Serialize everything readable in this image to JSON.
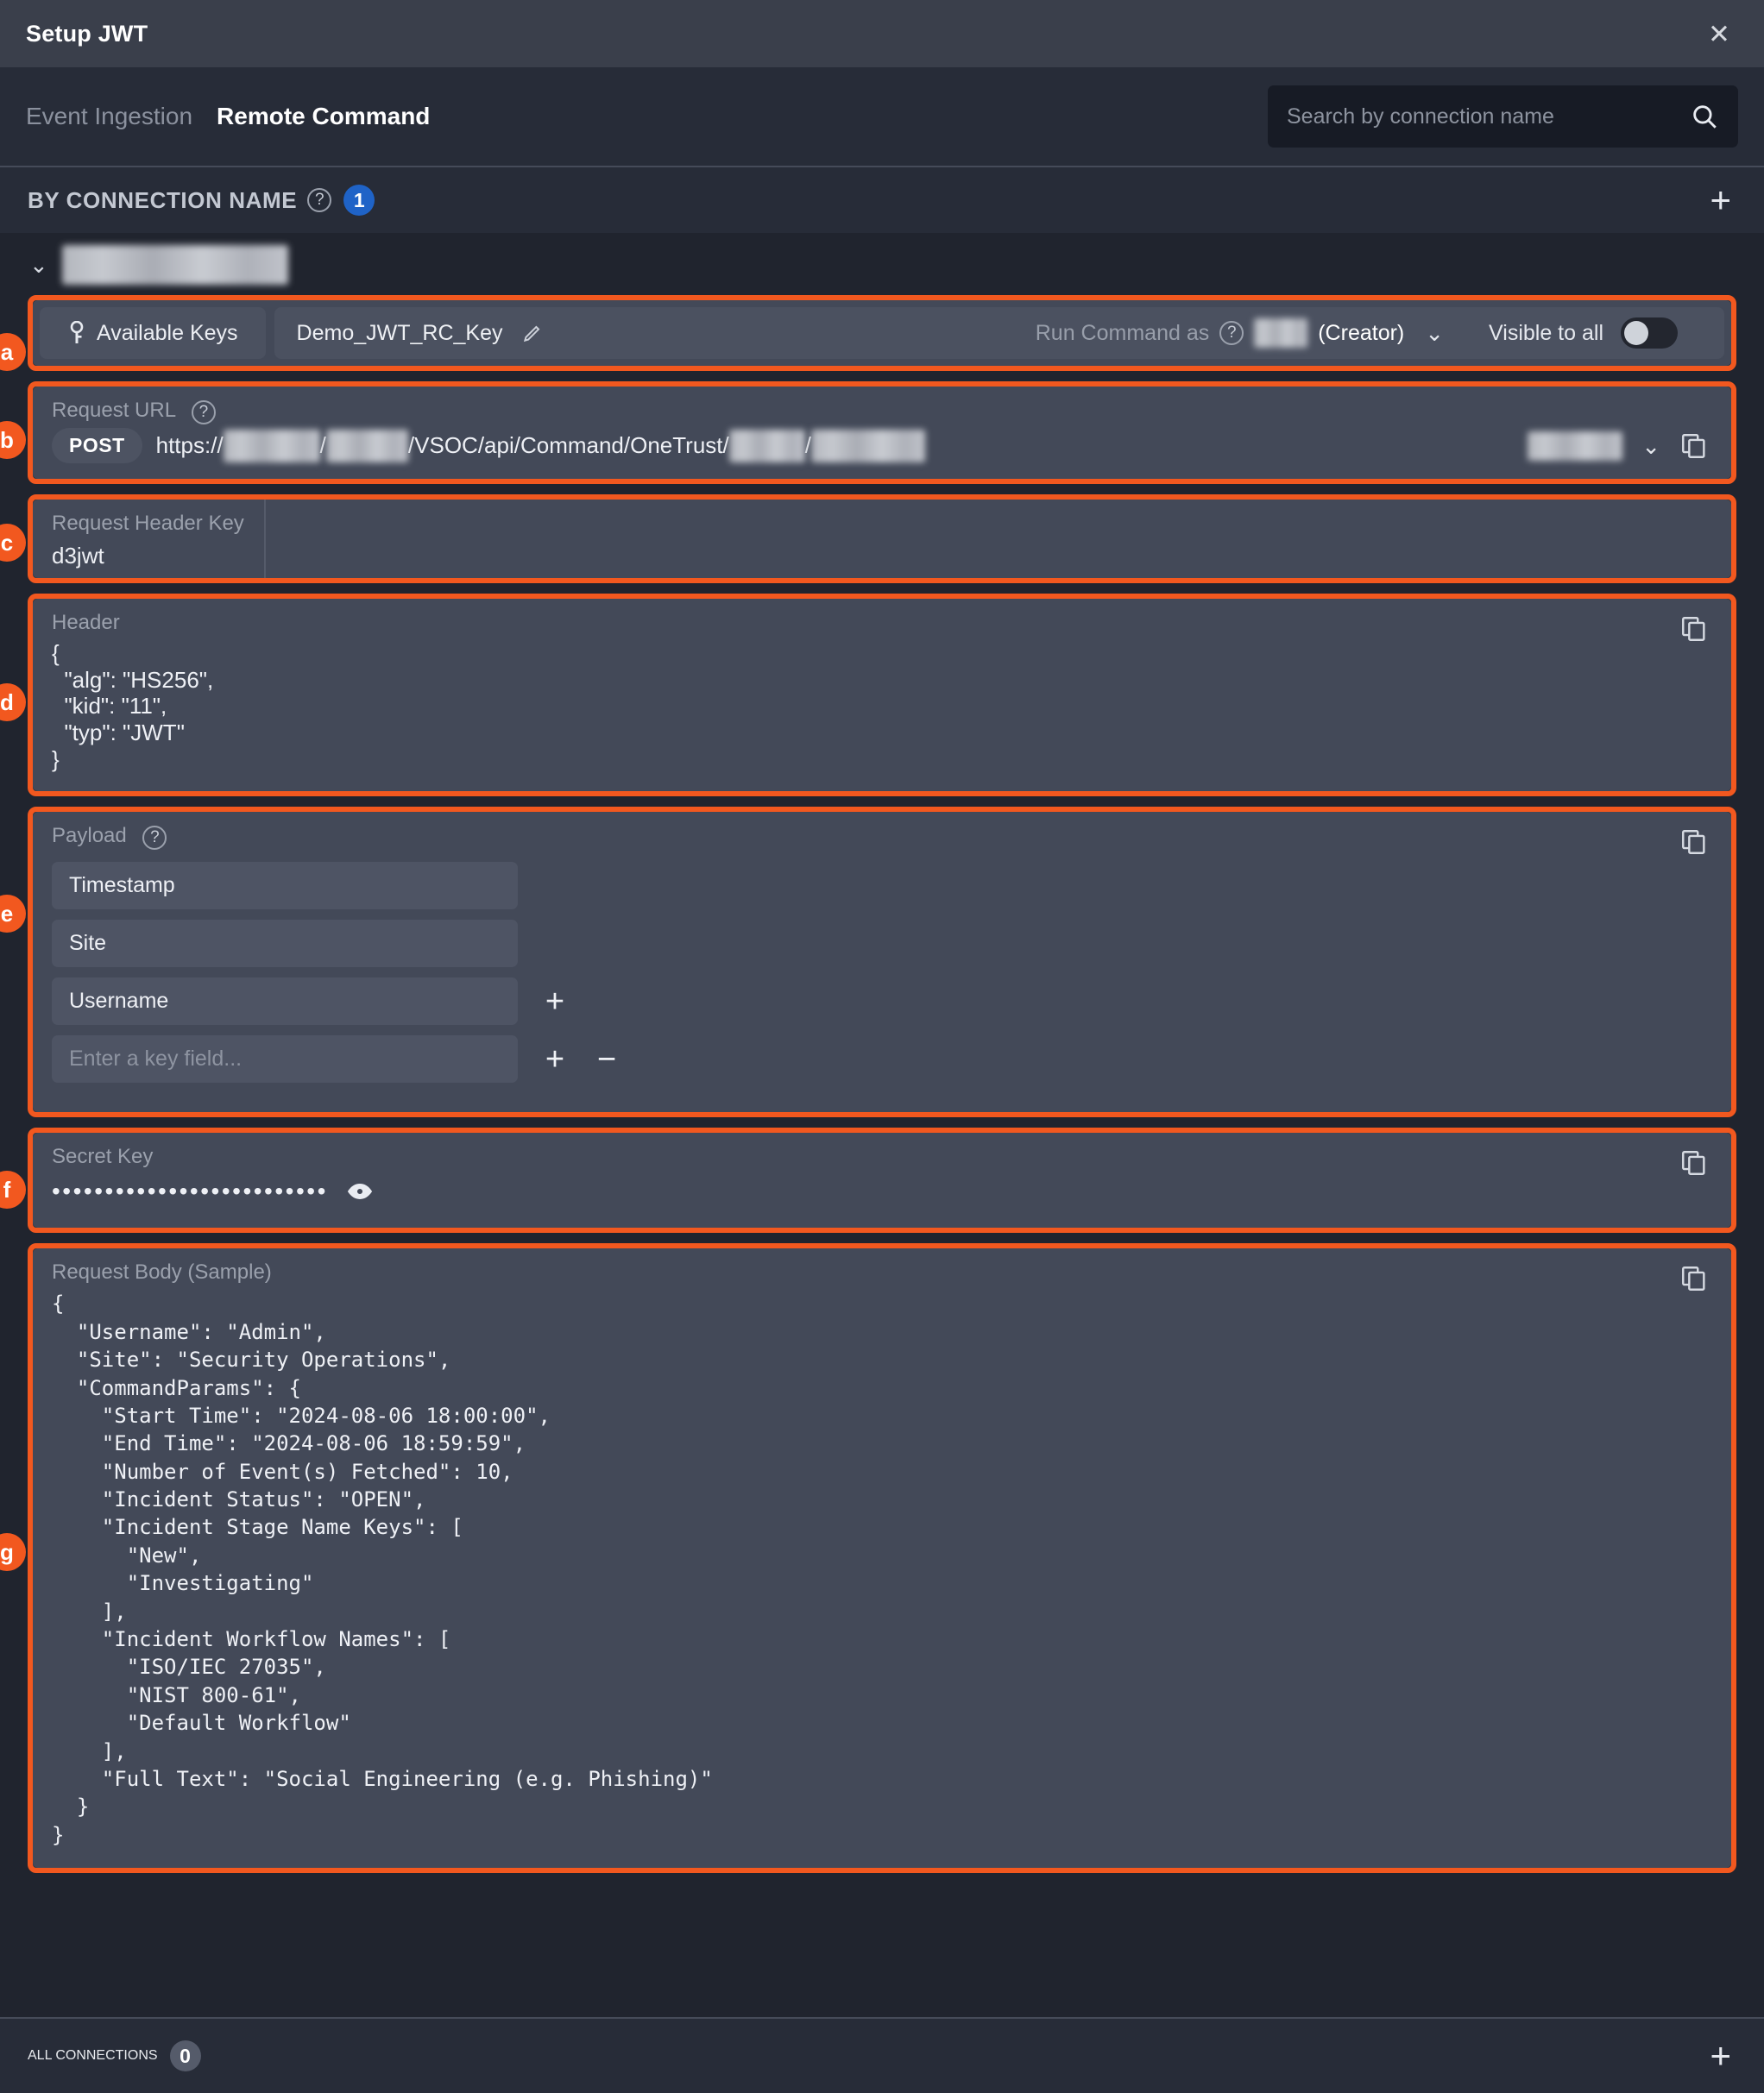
{
  "window": {
    "title": "Setup JWT",
    "close_icon": "close-icon"
  },
  "tabs": [
    {
      "label": "Event Ingestion",
      "active": false
    },
    {
      "label": "Remote Command",
      "active": true
    }
  ],
  "search": {
    "placeholder": "Search by connection name",
    "value": "",
    "icon": "search-icon"
  },
  "by_connection": {
    "label": "BY CONNECTION NAME",
    "help_icon": "question-mark-icon",
    "count": "1",
    "add_icon": "plus-icon"
  },
  "connection": {
    "chevron": "chevron-down-icon",
    "name_redacted": true
  },
  "group_a": {
    "badge": "a",
    "keys_tab_label": "Available Keys",
    "key_icon": "key-icon",
    "selected_key": "Demo_JWT_RC_Key",
    "edit_icon": "pencil-icon",
    "run_command_label": "Run Command as",
    "run_command_help": "question-mark-icon",
    "run_command_user_suffix": "(Creator)",
    "run_command_caret": "chevron-down-icon",
    "visible_to_all_label": "Visible to all",
    "visible_to_all_on": false
  },
  "group_b": {
    "badge": "b",
    "label": "Request URL",
    "help_icon": "question-mark-icon",
    "method": "POST",
    "url_prefix": "https://",
    "url_sep": "/",
    "url_middle": "/VSOC/api/Command/OneTrust/",
    "dropdown_caret": "chevron-down-icon",
    "copy_icon": "copy-icon"
  },
  "group_c": {
    "badge": "c",
    "label": "Request Header Key",
    "value": "d3jwt"
  },
  "group_d": {
    "badge": "d",
    "label": "Header",
    "copy_icon": "copy-icon",
    "content": "{\n  \"alg\": \"HS256\",\n  \"kid\": \"11\",\n  \"typ\": \"JWT\"\n}"
  },
  "group_e": {
    "badge": "e",
    "label": "Payload",
    "help_icon": "question-mark-icon",
    "copy_icon": "copy-icon",
    "fields": [
      {
        "value": "Timestamp",
        "placeholder": "Enter a key field...",
        "has_add": false,
        "has_remove": false
      },
      {
        "value": "Site",
        "placeholder": "Enter a key field...",
        "has_add": false,
        "has_remove": false
      },
      {
        "value": "Username",
        "placeholder": "Enter a key field...",
        "has_add": true,
        "has_remove": false
      },
      {
        "value": "",
        "placeholder": "Enter a key field...",
        "has_add": true,
        "has_remove": true
      }
    ],
    "add_icon": "plus-icon",
    "remove_icon": "minus-icon"
  },
  "group_f": {
    "badge": "f",
    "label": "Secret Key",
    "masked_value": "••••••••••••••••••••••••••",
    "reveal_icon": "eye-icon",
    "copy_icon": "copy-icon"
  },
  "group_g": {
    "badge": "g",
    "label": "Request Body (Sample)",
    "copy_icon": "copy-icon",
    "content": "{\n  \"Username\": \"Admin\",\n  \"Site\": \"Security Operations\",\n  \"CommandParams\": {\n    \"Start Time\": \"2024-08-06 18:00:00\",\n    \"End Time\": \"2024-08-06 18:59:59\",\n    \"Number of Event(s) Fetched\": 10,\n    \"Incident Status\": \"OPEN\",\n    \"Incident Stage Name Keys\": [\n      \"New\",\n      \"Investigating\"\n    ],\n    \"Incident Workflow Names\": [\n      \"ISO/IEC 27035\",\n      \"NIST 800-61\",\n      \"Default Workflow\"\n    ],\n    \"Full Text\": \"Social Engineering (e.g. Phishing)\"\n  }\n}"
  },
  "all_connections": {
    "label": "ALL CONNECTIONS",
    "count": "0",
    "add_icon": "plus-icon"
  },
  "colors": {
    "annotation": "#f2581f",
    "badge_blue": "#1f63c7",
    "titlebar": "#3a3f4b",
    "panel": "#434958",
    "page": "#20242e"
  }
}
